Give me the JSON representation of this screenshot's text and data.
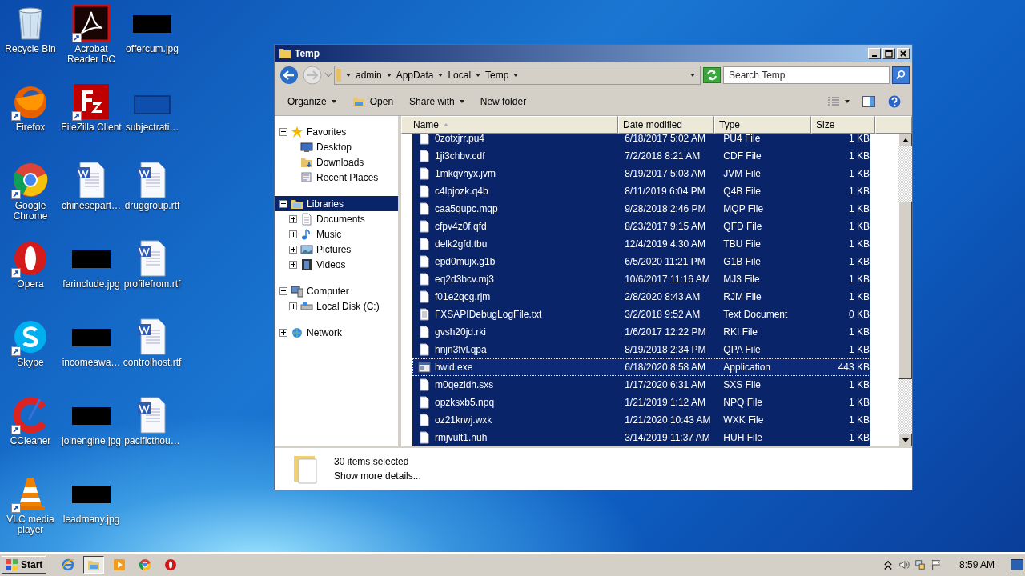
{
  "desktop_icons": [
    {
      "label": "Recycle Bin",
      "kind": "recycle",
      "shortcut": false
    },
    {
      "label": "Acrobat Reader DC",
      "kind": "acrobat",
      "shortcut": true
    },
    {
      "label": "offercum.jpg",
      "kind": "image",
      "shortcut": false
    },
    {
      "label": "Firefox",
      "kind": "firefox",
      "shortcut": true
    },
    {
      "label": "FileZilla Client",
      "kind": "filezilla",
      "shortcut": true
    },
    {
      "label": "subjectrati…",
      "kind": "blank",
      "shortcut": false
    },
    {
      "label": "Google Chrome",
      "kind": "chrome",
      "shortcut": true
    },
    {
      "label": "chinesepart…",
      "kind": "word",
      "shortcut": false
    },
    {
      "label": "druggroup.rtf",
      "kind": "word",
      "shortcut": false
    },
    {
      "label": "Opera",
      "kind": "opera",
      "shortcut": true
    },
    {
      "label": "farinclude.jpg",
      "kind": "image",
      "shortcut": false
    },
    {
      "label": "profilefrom.rtf",
      "kind": "word",
      "shortcut": false
    },
    {
      "label": "Skype",
      "kind": "skype",
      "shortcut": true
    },
    {
      "label": "incomeawa…",
      "kind": "image",
      "shortcut": false
    },
    {
      "label": "controlhost.rtf",
      "kind": "word",
      "shortcut": false
    },
    {
      "label": "CCleaner",
      "kind": "ccleaner",
      "shortcut": true
    },
    {
      "label": "joinengine.jpg",
      "kind": "image",
      "shortcut": false
    },
    {
      "label": "pacificthou…",
      "kind": "word",
      "shortcut": false
    },
    {
      "label": "VLC media player",
      "kind": "vlc",
      "shortcut": true
    },
    {
      "label": "leadmany.jpg",
      "kind": "image",
      "shortcut": false
    }
  ],
  "window": {
    "title": "Temp",
    "breadcrumb": [
      "admin",
      "AppData",
      "Local",
      "Temp"
    ],
    "search": {
      "placeholder": "Search Temp"
    },
    "toolbar": [
      {
        "label": "Organize",
        "kind": "menu"
      },
      {
        "label": "Open",
        "kind": "open"
      },
      {
        "label": "Share with",
        "kind": "menu"
      },
      {
        "label": "New folder",
        "kind": "plain"
      }
    ],
    "nav_tree": [
      {
        "label": "Favorites",
        "kind": "star",
        "expanded": true,
        "selected": false,
        "children": [
          {
            "label": "Desktop",
            "kind": "desktop",
            "selected": false
          },
          {
            "label": "Downloads",
            "kind": "downloads",
            "selected": false
          },
          {
            "label": "Recent Places",
            "kind": "recent",
            "selected": false
          }
        ]
      },
      {
        "label": "Libraries",
        "kind": "library",
        "expanded": true,
        "selected": true,
        "children": [
          {
            "label": "Documents",
            "kind": "documents",
            "expanded": false,
            "selected": false
          },
          {
            "label": "Music",
            "kind": "music",
            "expanded": false,
            "selected": false
          },
          {
            "label": "Pictures",
            "kind": "pictures",
            "expanded": false,
            "selected": false
          },
          {
            "label": "Videos",
            "kind": "videos",
            "expanded": false,
            "selected": false
          }
        ]
      },
      {
        "label": "Computer",
        "kind": "computer",
        "expanded": true,
        "selected": false,
        "children": [
          {
            "label": "Local Disk (C:)",
            "kind": "disk",
            "expanded": false,
            "selected": false
          }
        ]
      },
      {
        "label": "Network",
        "kind": "network",
        "expanded": false,
        "selected": false
      }
    ],
    "columns": [
      {
        "label": "Name",
        "sorted": true
      },
      {
        "label": "Date modified",
        "sorted": false
      },
      {
        "label": "Type",
        "sorted": false
      },
      {
        "label": "Size",
        "sorted": false
      }
    ],
    "rows": [
      {
        "name": "0zotxjrr.pu4",
        "date": "6/18/2017 5:02 AM",
        "type": "PU4 File",
        "size": "1 KB",
        "kind": "file",
        "selected": true,
        "focused": false
      },
      {
        "name": "1ji3chbv.cdf",
        "date": "7/2/2018 8:21 AM",
        "type": "CDF File",
        "size": "1 KB",
        "kind": "file",
        "selected": true,
        "focused": false
      },
      {
        "name": "1mkqvhyx.jvm",
        "date": "8/19/2017 5:03 AM",
        "type": "JVM File",
        "size": "1 KB",
        "kind": "file",
        "selected": true,
        "focused": false
      },
      {
        "name": "c4lpjozk.q4b",
        "date": "8/11/2019 6:04 PM",
        "type": "Q4B File",
        "size": "1 KB",
        "kind": "file",
        "selected": true,
        "focused": false
      },
      {
        "name": "caa5qupc.mqp",
        "date": "9/28/2018 2:46 PM",
        "type": "MQP File",
        "size": "1 KB",
        "kind": "file",
        "selected": true,
        "focused": false
      },
      {
        "name": "cfpv4z0f.qfd",
        "date": "8/23/2017 9:15 AM",
        "type": "QFD File",
        "size": "1 KB",
        "kind": "file",
        "selected": true,
        "focused": false
      },
      {
        "name": "delk2gfd.tbu",
        "date": "12/4/2019 4:30 AM",
        "type": "TBU File",
        "size": "1 KB",
        "kind": "file",
        "selected": true,
        "focused": false
      },
      {
        "name": "epd0mujx.g1b",
        "date": "6/5/2020 11:21 PM",
        "type": "G1B File",
        "size": "1 KB",
        "kind": "file",
        "selected": true,
        "focused": false
      },
      {
        "name": "eq2d3bcv.mj3",
        "date": "10/6/2017 11:16 AM",
        "type": "MJ3 File",
        "size": "1 KB",
        "kind": "file",
        "selected": true,
        "focused": false
      },
      {
        "name": "f01e2qcg.rjm",
        "date": "2/8/2020 8:43 AM",
        "type": "RJM File",
        "size": "1 KB",
        "kind": "file",
        "selected": true,
        "focused": false
      },
      {
        "name": "FXSAPIDebugLogFile.txt",
        "date": "3/2/2018 9:52 AM",
        "type": "Text Document",
        "size": "0 KB",
        "kind": "text",
        "selected": true,
        "focused": false
      },
      {
        "name": "gvsh20jd.rki",
        "date": "1/6/2017 12:22 PM",
        "type": "RKI File",
        "size": "1 KB",
        "kind": "file",
        "selected": true,
        "focused": false
      },
      {
        "name": "hnjn3fvl.qpa",
        "date": "8/19/2018 2:34 PM",
        "type": "QPA File",
        "size": "1 KB",
        "kind": "file",
        "selected": true,
        "focused": false
      },
      {
        "name": "hwid.exe",
        "date": "6/18/2020 8:58 AM",
        "type": "Application",
        "size": "443 KB",
        "kind": "app",
        "selected": true,
        "focused": true
      },
      {
        "name": "m0qezidh.sxs",
        "date": "1/17/2020 6:31 AM",
        "type": "SXS File",
        "size": "1 KB",
        "kind": "file",
        "selected": true,
        "focused": false
      },
      {
        "name": "opzksxb5.npq",
        "date": "1/21/2019 1:12 AM",
        "type": "NPQ File",
        "size": "1 KB",
        "kind": "file",
        "selected": true,
        "focused": false
      },
      {
        "name": "oz21krwj.wxk",
        "date": "1/21/2020 10:43 AM",
        "type": "WXK File",
        "size": "1 KB",
        "kind": "file",
        "selected": true,
        "focused": false
      },
      {
        "name": "rmjvult1.huh",
        "date": "3/14/2019 11:37 AM",
        "type": "HUH File",
        "size": "1 KB",
        "kind": "file",
        "selected": true,
        "focused": false
      }
    ],
    "details": {
      "summary": "30 items selected",
      "link": "Show more details..."
    }
  },
  "taskbar": {
    "start": "Start",
    "apps": [
      {
        "kind": "ie",
        "active": false
      },
      {
        "kind": "explorer",
        "active": true
      },
      {
        "kind": "media",
        "active": false
      },
      {
        "kind": "chrome",
        "active": false
      },
      {
        "kind": "opera",
        "active": false
      }
    ],
    "clock": "8:59 AM"
  }
}
